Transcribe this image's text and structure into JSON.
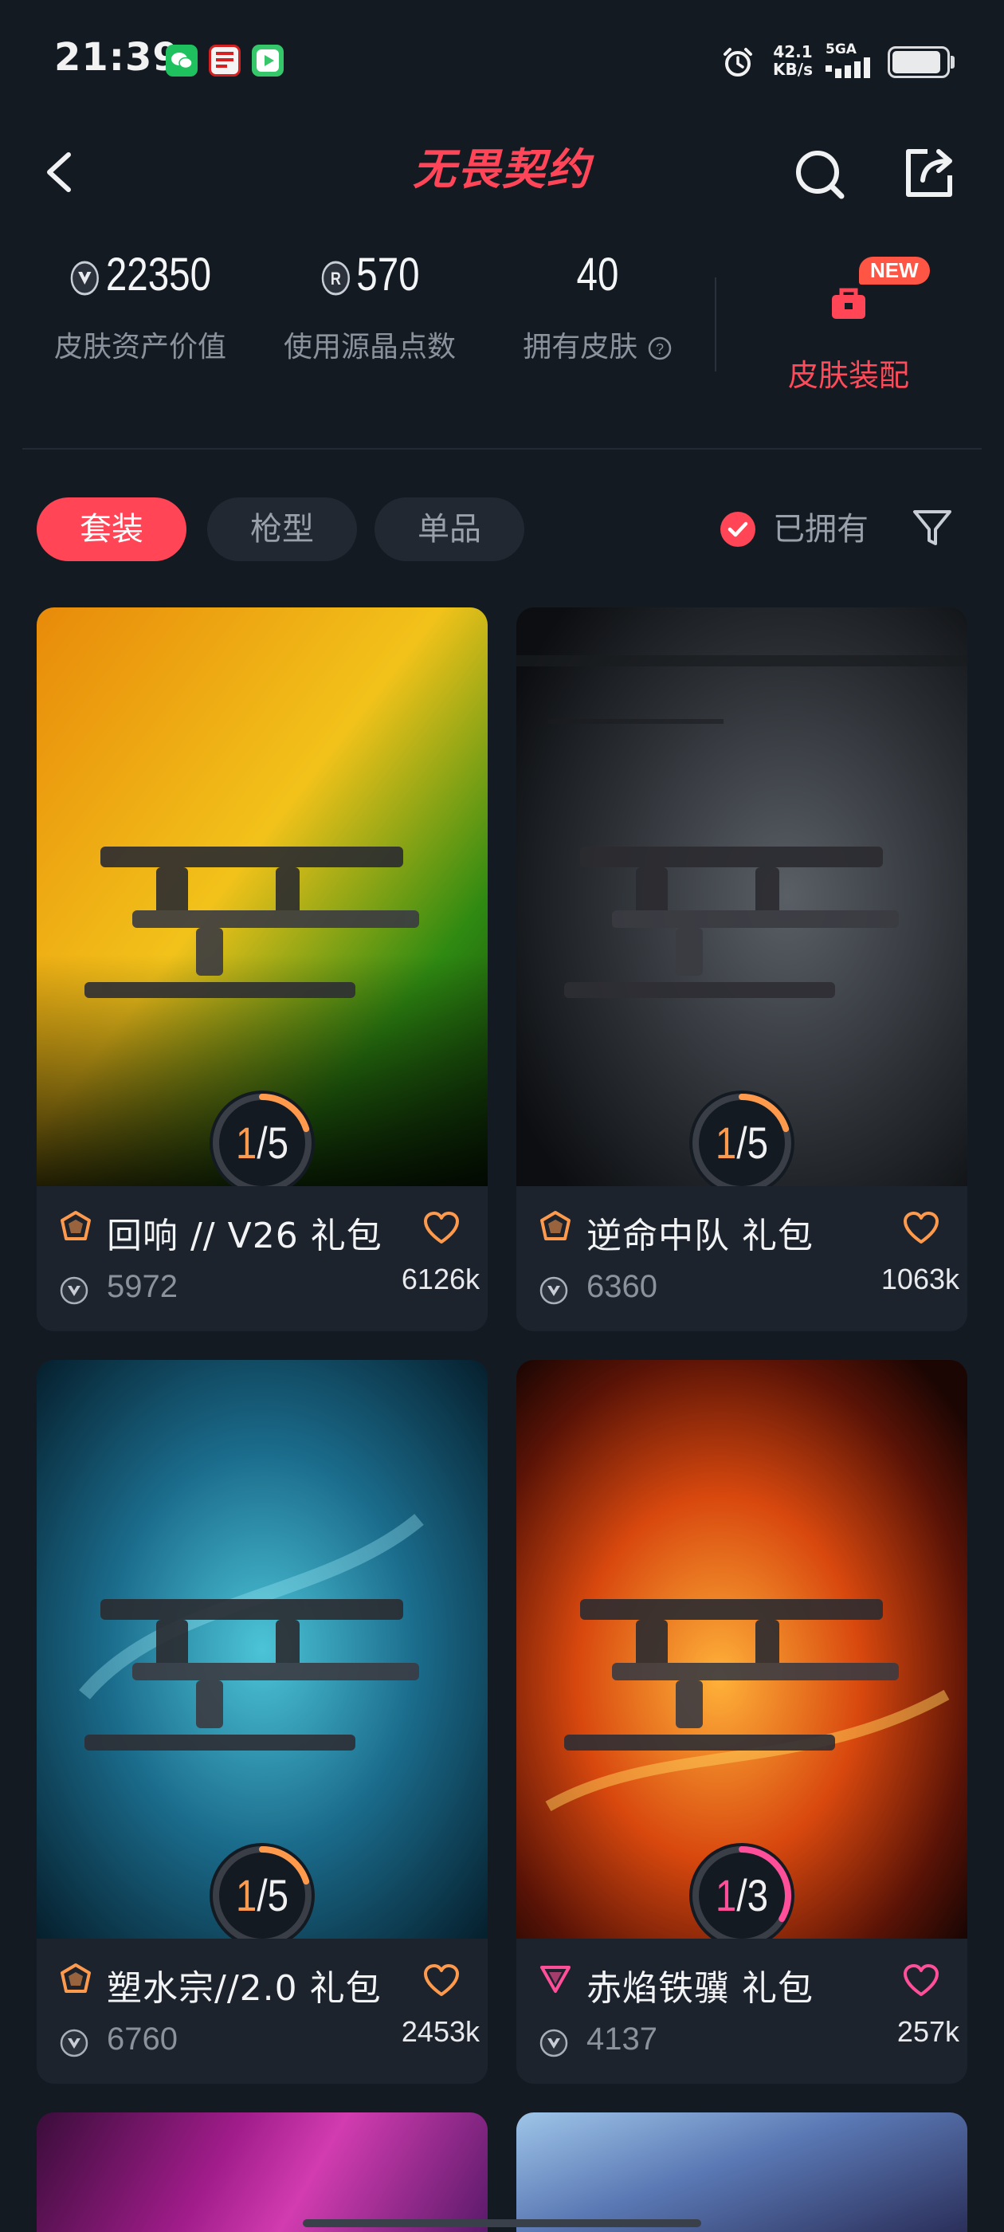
{
  "status_bar": {
    "time": "21:39",
    "speed_value": "42.1",
    "speed_unit": "KB/s",
    "network": "5GA",
    "battery_level": 0.92
  },
  "header": {
    "title": "无畏契约"
  },
  "stats": {
    "asset_value": "22350",
    "asset_label": "皮肤资产价值",
    "radianite": "570",
    "radianite_label": "使用源晶点数",
    "owned_skins": "40",
    "owned_skins_label": "拥有皮肤",
    "outfit_label": "皮肤装配",
    "outfit_badge": "NEW"
  },
  "filters": {
    "tabs": [
      "套装",
      "枪型",
      "单品"
    ],
    "active_tab": 0,
    "owned_label": "已拥有",
    "owned_checked": true
  },
  "colors": {
    "accent": "#ff4556",
    "progress_orange": "#ff8a3d",
    "progress_pink": "#ff4f9a",
    "background": "#141a22",
    "card": "#1d232c"
  },
  "cards": [
    {
      "title": "回响 // V26 礼包",
      "price": "5972",
      "count": "6126k",
      "owned": 1,
      "total": 5,
      "progress_label": "1/5",
      "tier": "premium-icon",
      "tier_color": "#ff9a4d",
      "theme": "echo"
    },
    {
      "title": "逆命中队 礼包",
      "price": "6360",
      "count": "1063k",
      "owned": 1,
      "total": 5,
      "progress_label": "1/5",
      "tier": "premium-icon",
      "tier_color": "#ff9a4d",
      "theme": "squad"
    },
    {
      "title": "塑水宗//2.0 礼包",
      "price": "6760",
      "count": "2453k",
      "owned": 1,
      "total": 5,
      "progress_label": "1/5",
      "tier": "premium-icon",
      "tier_color": "#ff9a4d",
      "theme": "water"
    },
    {
      "title": "赤焰铁骥 礼包",
      "price": "4137",
      "count": "257k",
      "owned": 1,
      "total": 3,
      "progress_label": "1/3",
      "tier": "exclusive-icon",
      "tier_color": "#ff4f9a",
      "theme": "fire"
    }
  ]
}
